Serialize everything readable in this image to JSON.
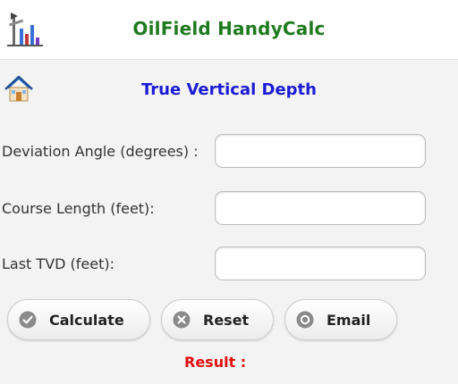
{
  "app": {
    "title": "OilField HandyCalc"
  },
  "section": {
    "title": "True Vertical Depth"
  },
  "form": {
    "deviation_label": "Deviation Angle (degrees) :",
    "deviation_value": "",
    "course_label": "Course Length (feet):",
    "course_value": "",
    "last_tvd_label": "Last TVD (feet):",
    "last_tvd_value": ""
  },
  "buttons": {
    "calculate": "Calculate",
    "reset": "Reset",
    "email": "Email"
  },
  "result": {
    "label": "Result :",
    "value": ""
  },
  "icons": {
    "logo": "oil-pump-chart-icon",
    "home": "home-icon",
    "calculate": "check-circle-icon",
    "reset": "x-circle-icon",
    "email": "at-circle-icon"
  },
  "colors": {
    "app_title": "#1f7a1f",
    "section_title": "#1b1bd6",
    "result": "#e01010"
  }
}
